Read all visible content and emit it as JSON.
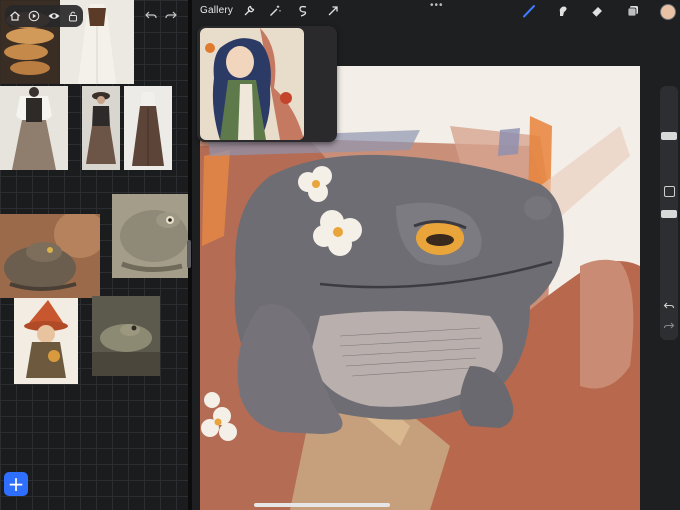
{
  "top_bar": {
    "gallery_label": "Gallery",
    "more_label": "•••",
    "icons": [
      "wrench-icon",
      "magic-wand-icon",
      "selection-icon",
      "transform-arrow-icon",
      "brush-icon",
      "smudge-icon",
      "eraser-icon",
      "layers-icon"
    ],
    "current_color": "#e9c2a6",
    "active_tool_color": "#3d7bff"
  },
  "left_toolbar": {
    "icons": [
      "home-icon",
      "play-icon",
      "eye-icon",
      "lock-icon"
    ]
  },
  "add_button": {
    "label": "+"
  },
  "colors": {
    "canvas_paper": "#f3efe8",
    "toad_body": "#6e6d73",
    "toad_belly": "#b9b0ad",
    "toad_eye": "#e9a43a",
    "branch": "#b86b4f",
    "accent": "#2f6fff"
  }
}
